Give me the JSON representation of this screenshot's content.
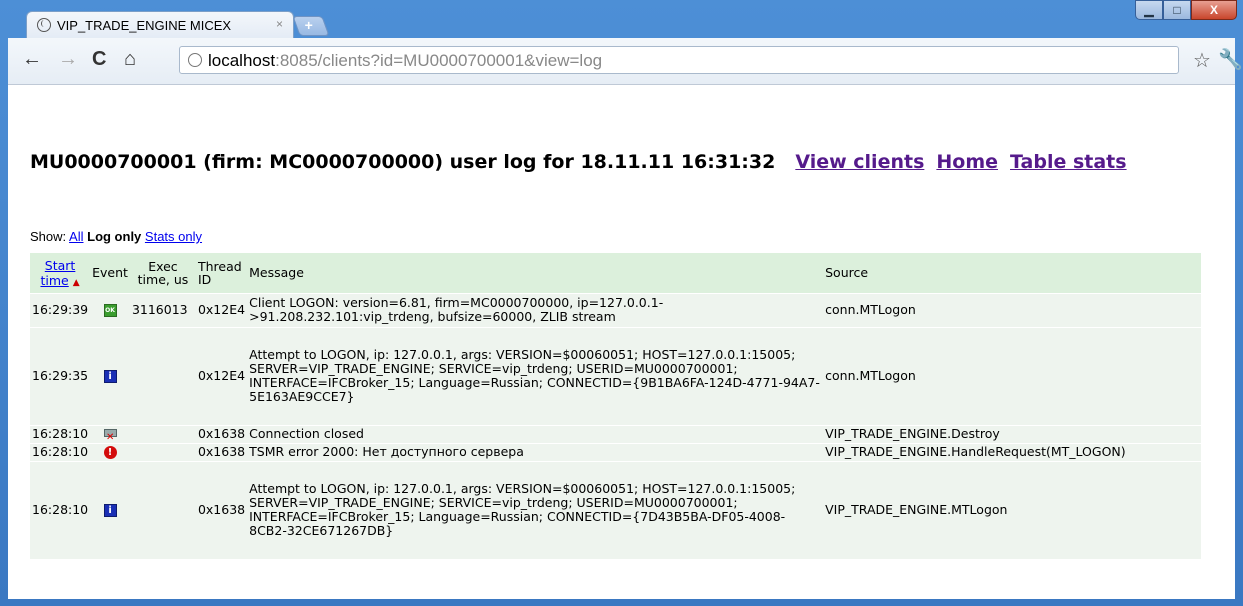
{
  "browser": {
    "tab_title": "VIP_TRADE_ENGINE MICEX",
    "tab_close": "×",
    "new_tab": "+",
    "url_host": "localhost",
    "url_rest": ":8085/clients?id=MU0000700001&view=log",
    "window_buttons": {
      "minimize": "▁",
      "maximize": "□",
      "close": "X"
    }
  },
  "page": {
    "heading_text": "MU0000700001 (firm: MC0000700000) user log for 18.11.11 16:31:32",
    "links": {
      "view_clients": "View clients",
      "home": "Home",
      "table_stats": "Table stats"
    },
    "show": {
      "label": "Show:",
      "all": "All",
      "log_only": "Log only",
      "stats_only": "Stats only"
    }
  },
  "table": {
    "headers": {
      "start_time": "Start time",
      "event": "Event",
      "exec_time": "Exec time, us",
      "thread_id": "Thread ID",
      "message": "Message",
      "source": "Source"
    },
    "rows": [
      {
        "time": "16:29:39",
        "event": "ok-icon",
        "exec": "3116013",
        "thread": "0x12E4",
        "message": "Client LOGON: version=6.81, firm=MC0000700000, ip=127.0.0.1->91.208.232.101:vip_trdeng, bufsize=60000, ZLIB stream",
        "source": "conn.MTLogon"
      },
      {
        "time": "16:29:35",
        "event": "info-icon",
        "exec": "",
        "thread": "0x12E4",
        "message": "Attempt to LOGON, ip: 127.0.0.1, args: VERSION=$00060051; HOST=127.0.0.1:15005; SERVER=VIP_TRADE_ENGINE; SERVICE=vip_trdeng; USERID=MU0000700001; INTERFACE=IFCBroker_15; Language=Russian; CONNECTID={9B1BA6FA-124D-4771-94A7-5E163AE9CCE7}",
        "source": "conn.MTLogon"
      },
      {
        "time": "16:28:10",
        "event": "disconnect-icon",
        "exec": "",
        "thread": "0x1638",
        "message": "Connection closed",
        "source": "VIP_TRADE_ENGINE.Destroy"
      },
      {
        "time": "16:28:10",
        "event": "error-icon",
        "exec": "",
        "thread": "0x1638",
        "message": "TSMR error 2000: Нет доступного сервера",
        "source": "VIP_TRADE_ENGINE.HandleRequest(MT_LOGON)"
      },
      {
        "time": "16:28:10",
        "event": "info-icon",
        "exec": "",
        "thread": "0x1638",
        "message": "Attempt to LOGON, ip: 127.0.0.1, args: VERSION=$00060051; HOST=127.0.0.1:15005; SERVER=VIP_TRADE_ENGINE; SERVICE=vip_trdeng; USERID=MU0000700001; INTERFACE=IFCBroker_15; Language=Russian; CONNECTID={7D43B5BA-DF05-4008-8CB2-32CE671267DB}",
        "source": "VIP_TRADE_ENGINE.MTLogon"
      }
    ]
  }
}
